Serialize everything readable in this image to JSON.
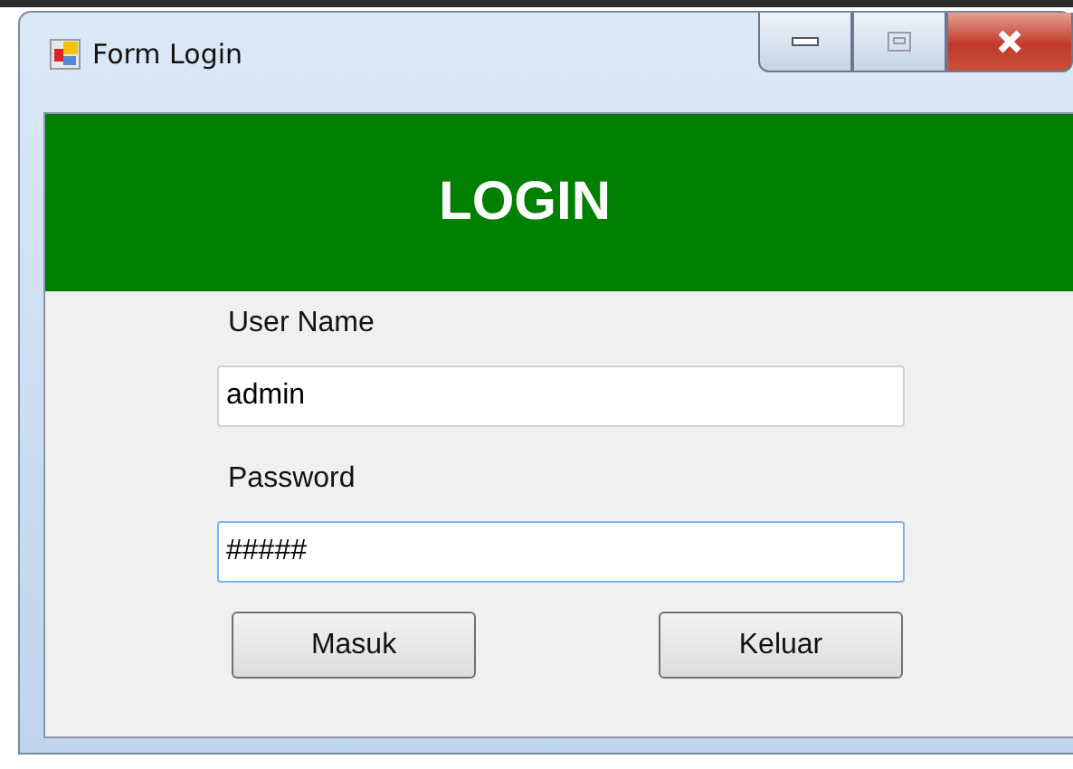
{
  "window": {
    "title": "Form Login"
  },
  "header": {
    "title": "LOGIN"
  },
  "fields": [
    {
      "label": "User Name",
      "value": "admin",
      "focused": false
    },
    {
      "label": "Password",
      "value": "#####",
      "focused": true
    }
  ],
  "buttons": [
    "Masuk",
    "Keluar"
  ]
}
